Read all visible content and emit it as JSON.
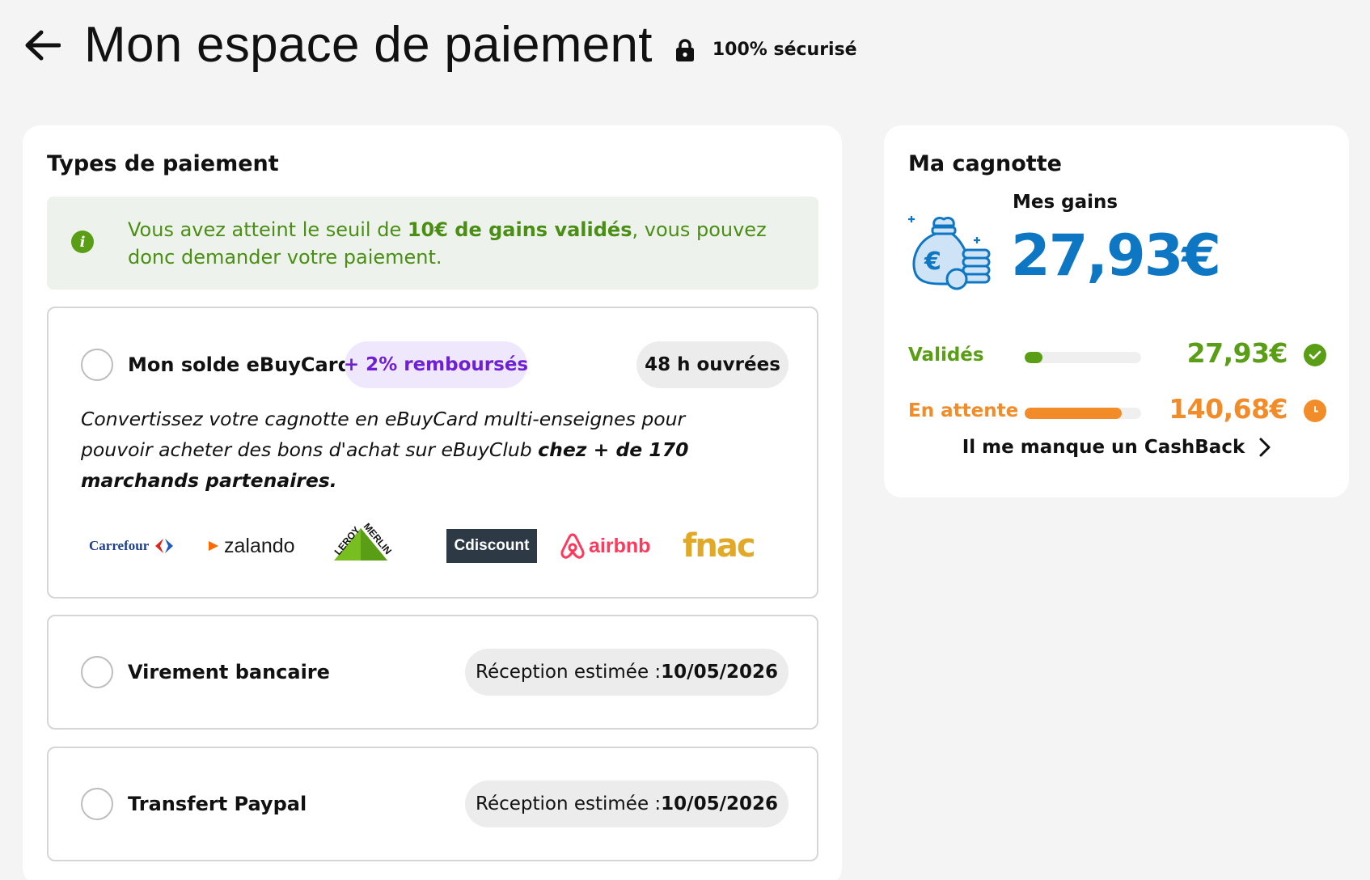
{
  "header": {
    "title": "Mon espace de paiement",
    "secure_label": "100% sécurisé"
  },
  "payment_types": {
    "title": "Types de paiement",
    "info": {
      "text_before": "Vous avez atteint le seuil de ",
      "text_bold": "10€ de gains validés",
      "text_after": ", vous pouvez donc demander votre paiement."
    },
    "options": [
      {
        "label": "Mon solde eBuyCard",
        "badge": "+ 2% remboursés",
        "delay": "48 h ouvrées",
        "description_before": "Convertissez votre cagnotte en eBuyCard multi-enseignes pour pouvoir acheter des bons d'achat sur eBuyClub ",
        "description_bold": "chez + de 170 marchands partenaires.",
        "logos": [
          "Carrefour",
          "zalando",
          "LEROY MERLIN",
          "Cdiscount",
          "airbnb",
          "fnac"
        ]
      },
      {
        "label": "Virement bancaire",
        "reception_label": "Réception estimée : ",
        "reception_date": "10/05/2026"
      },
      {
        "label": "Transfert Paypal",
        "reception_label": "Réception estimée : ",
        "reception_date": "10/05/2026"
      }
    ]
  },
  "cagnotte": {
    "title": "Ma cagnotte",
    "gains_label": "Mes gains",
    "gains_amount": "27,93€",
    "rows": [
      {
        "label": "Validés",
        "value": "27,93€",
        "progress": 0.15,
        "color": "#5a9e16"
      },
      {
        "label": "En attente",
        "value": "140,68€",
        "progress": 0.83,
        "color": "#f28c28"
      }
    ],
    "missing_cashback": "Il me manque un CashBack"
  },
  "colors": {
    "blue": "#0e77c4",
    "green": "#5a9e16",
    "orange": "#f28c28",
    "purple": "#6f1fd6"
  }
}
